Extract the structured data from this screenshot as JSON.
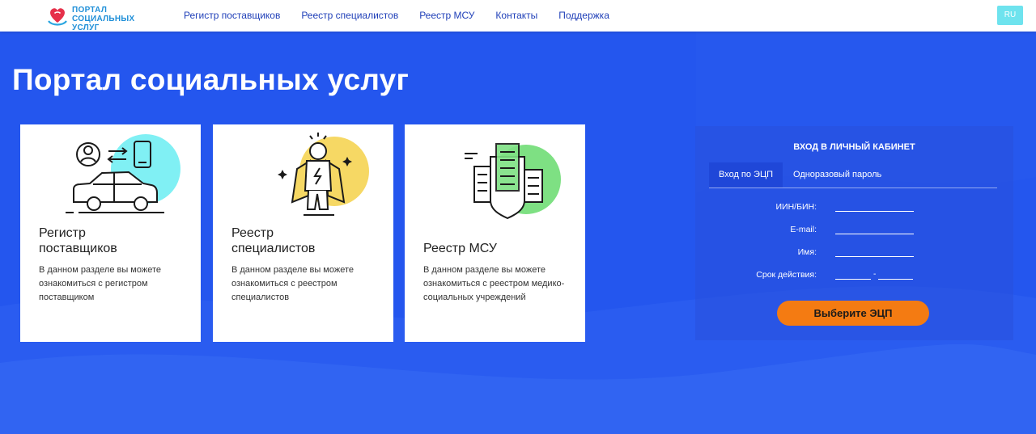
{
  "header": {
    "logo_line1": "Портал",
    "logo_line2": "социальных услуг",
    "nav": [
      "Регистр поставщиков",
      "Реестр специалистов",
      "Реестр МСУ",
      "Контакты",
      "Поддержка"
    ],
    "lang": "RU"
  },
  "page_title": "Портал социальных услуг",
  "cards": [
    {
      "title_line1": "Регистр",
      "title_line2": "поставщиков",
      "desc_lines": [
        "В данном разделе вы можете",
        "ознакомиться с регистром",
        "поставщиком"
      ],
      "icons": [
        "user-circle-icon",
        "swap-arrows-icon",
        "phone-icon",
        "car-icon"
      ],
      "accent": "#80f0f4"
    },
    {
      "title_line1": "Реестр",
      "title_line2": "специалистов",
      "desc_lines": [
        "В данном разделе вы можете",
        "ознакомиться с реестром",
        "специалистов"
      ],
      "icons": [
        "superhero-icon",
        "sparkle-icon"
      ],
      "accent": "#f6d864"
    },
    {
      "title_line1": "Реестр МСУ",
      "desc_lines": [
        "В данном разделе вы можете",
        "ознакомиться с реестром медико-",
        "социальных учреждений"
      ],
      "icons": [
        "buildings-shield-icon"
      ],
      "accent": "#7ee083"
    }
  ],
  "login": {
    "title": "ВХОД В ЛИЧНЫЙ КАБИНЕТ",
    "tabs": [
      "Вход по ЭЦП",
      "Одноразовый пароль"
    ],
    "fields": {
      "iin": "ИИН/БИН:",
      "email": "E-mail:",
      "name": "Имя:",
      "validity": "Срок действия:",
      "validity_sep": "-"
    },
    "button": "Выберите ЭЦП"
  },
  "colors": {
    "background": "#2456ee",
    "button": "#f47b12",
    "nav_text": "#1f3fb8",
    "lang_bg": "#6ee3ee"
  }
}
